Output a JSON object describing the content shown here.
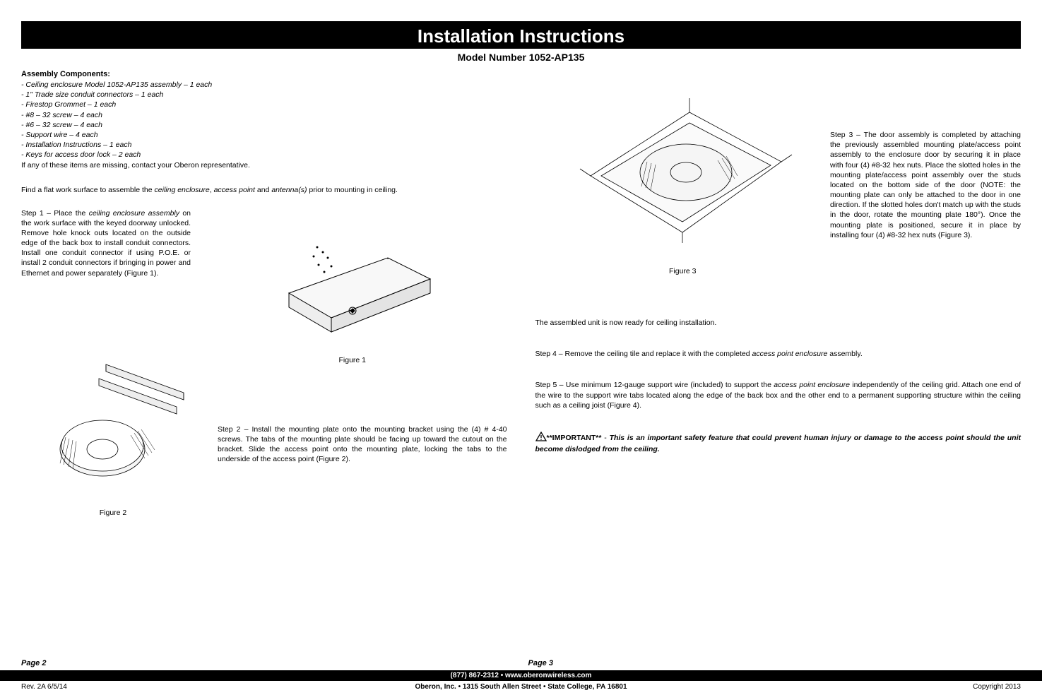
{
  "title": "Installation Instructions",
  "subtitle": "Model Number 1052-AP135",
  "assembly": {
    "heading": "Assembly Components:",
    "items": [
      "- Ceiling enclosure Model 1052-AP135 assembly – 1 each",
      "- 1\" Trade size conduit connectors – 1 each",
      "- Firestop Grommet – 1 each",
      "- #8 – 32 screw – 4 each",
      "- #6 – 32 screw – 4 each",
      "- Support wire – 4 each",
      "- Installation Instructions – 1 each",
      "- Keys for access door lock – 2 each"
    ],
    "note": "If any of these items are missing, contact your Oberon representative."
  },
  "find_flat_prefix": "Find a flat work surface to assemble the ",
  "find_flat_i1": "ceiling enclosure",
  "find_flat_mid1": ", ",
  "find_flat_i2": "access point",
  "find_flat_mid2": " and ",
  "find_flat_i3": "antenna(s)",
  "find_flat_suffix": " prior to mounting in ceiling.",
  "step1_prefix": "Step 1 – Place the ",
  "step1_i1": "ceiling enclosure assembly",
  "step1_body": " on the work surface with the keyed doorway unlocked. Remove hole knock outs located on the outside edge of the back box to install conduit connectors. Install one conduit connector if using P.O.E. or install 2 conduit connectors if bringing in power and Ethernet and power separately (Figure 1).",
  "fig1": "Figure 1",
  "step2": "Step 2 – Install the mounting plate onto the mounting bracket using the (4) # 4-40 screws. The tabs of the mounting plate should be facing up toward the cutout on the bracket. Slide the access point onto the mounting plate, locking the tabs to the underside of the access point (Figure 2).",
  "fig2": "Figure 2",
  "step3": "Step 3 – The door assembly is completed by attaching the previously assembled mounting plate/access point assembly to the enclosure door by securing it in place with four (4) #8-32 hex nuts. Place the slotted holes in the mounting plate/access point assembly over the studs located on the bottom side of the door (NOTE: the mounting plate can only be attached to the door in one direction. If the slotted holes don't match up with the studs in the door, rotate the mounting plate 180°). Once the mounting plate is positioned, secure it in place by installing four (4) #8-32 hex nuts (Figure 3).",
  "fig3": "Figure 3",
  "assembled": "The assembled unit is now ready for ceiling installation.",
  "step4_prefix": "Step 4 – Remove the ceiling tile and replace it with the completed ",
  "step4_i1": "access point enclosure",
  "step4_suffix": " assembly.",
  "step5_prefix": "Step 5 – Use minimum 12-gauge support wire (included) to support the ",
  "step5_i1": "access point enclosure",
  "step5_suffix": " independently of the ceiling grid. Attach one end of the wire to the support wire tabs located along the edge of the back box and the other end to a permanent supporting structure within the ceiling such as a ceiling joist (Figure 4).",
  "important_label": "**IMPORTANT**",
  "important_dash": " - ",
  "important_body": "This is an important safety feature that could prevent human injury or damage to the access point should the unit become dislodged from the ceiling.",
  "page2": "Page 2",
  "page3": "Page 3",
  "footer_phone": "(877) 867-2312  •  www.oberonwireless.com",
  "footer_rev": "Rev. 2A 6/5/14",
  "footer_addr": "Oberon, Inc.  •  1315 South Allen Street  •  State College, PA 16801",
  "footer_copy": "Copyright 2013"
}
